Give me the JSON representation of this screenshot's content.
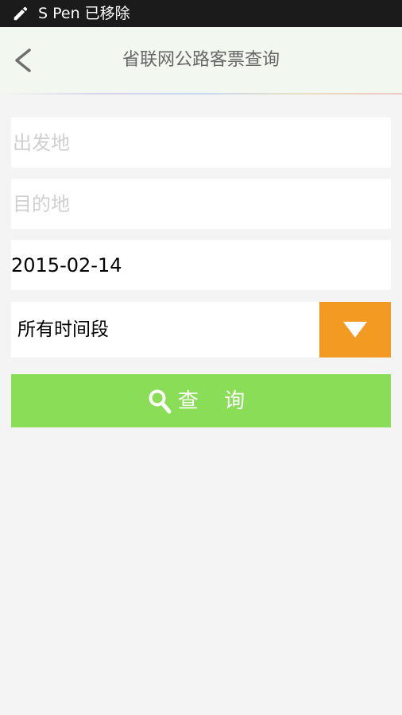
{
  "status_bar": {
    "text": "S Pen 已移除",
    "icon": "pen-icon"
  },
  "header": {
    "back_icon": "chevron-left-icon",
    "title": "省联网公路客票查询"
  },
  "form": {
    "from_placeholder": "出发地",
    "from_value": "",
    "to_placeholder": "目的地",
    "to_value": "",
    "date_value": "2015-02-14",
    "time_period": {
      "selected": "所有时间段",
      "icon": "triangle-down-icon"
    },
    "query_button": {
      "label": "查 询",
      "icon": "search-icon"
    }
  },
  "colors": {
    "status_bar_bg": "#1b1b1b",
    "header_bg": "#f2f8ef",
    "page_bg": "#f4f4f4",
    "dropdown_accent": "#f39a22",
    "query_button_bg": "#8add57"
  }
}
